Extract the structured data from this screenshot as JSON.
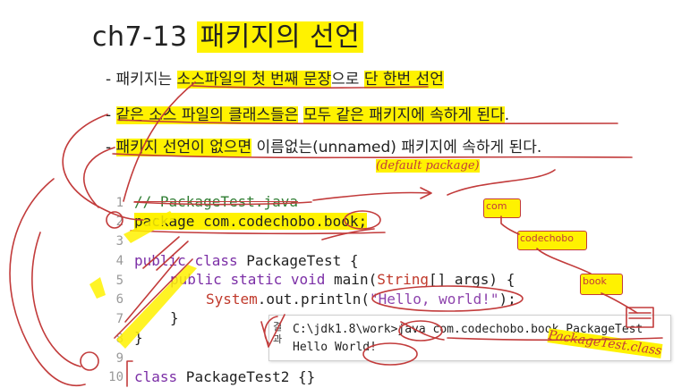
{
  "title": {
    "code": "ch7-13",
    "text": "패키지의 선언"
  },
  "bullets": [
    {
      "prefix": "- 패키지는 ",
      "a": "소스파일의 첫 번째 문장",
      "b": "으로 ",
      "c": "단 한번 선언"
    },
    {
      "prefix": "- ",
      "a": "같은 소스 파일의 클래스들은",
      "b": "  ",
      "c": "모두 같은 패키지에 속하게 된다",
      "d": "."
    },
    {
      "prefix": "- ",
      "a": "패키지 선언이 없으면",
      "b": " 이름없는(unnamed) 패키지에 속하게 된다."
    }
  ],
  "code": {
    "line_numbers": [
      "1",
      "2",
      "3",
      "4",
      "5",
      "6",
      "7",
      "8",
      "9",
      "10"
    ],
    "l1": "// PackageTest.java",
    "l2_kw": "package",
    "l2_rest": " com.codechobo.book;",
    "l4_kw1": "public",
    "l4_kw2": "class",
    "l4_rest": " PackageTest {",
    "l5_kw1": "public",
    "l5_kw2": "static",
    "l5_kw3": "void",
    "l5_a": " main(",
    "l5_type": "String",
    "l5_b": "[] args) {",
    "l6_a": "System",
    "l6_b": ".out.println(",
    "l6_str": "\"Hello, world!\"",
    "l6_c": ");",
    "l7": "}",
    "l8": "}",
    "l10_kw": "class",
    "l10_rest": " PackageTest2 {}"
  },
  "console": {
    "side_label": "결과",
    "line1": "C:\\jdk1.8\\work>java com.codechobo.book.PackageTest",
    "line2": "Hello World!"
  },
  "annotations": {
    "default_package": "(default package)",
    "com": "com",
    "codechobo": "codechobo",
    "book": "book",
    "class_file": "PackageTest.class"
  },
  "colors": {
    "highlight": "#fff200",
    "ink": "#c23b3b"
  }
}
